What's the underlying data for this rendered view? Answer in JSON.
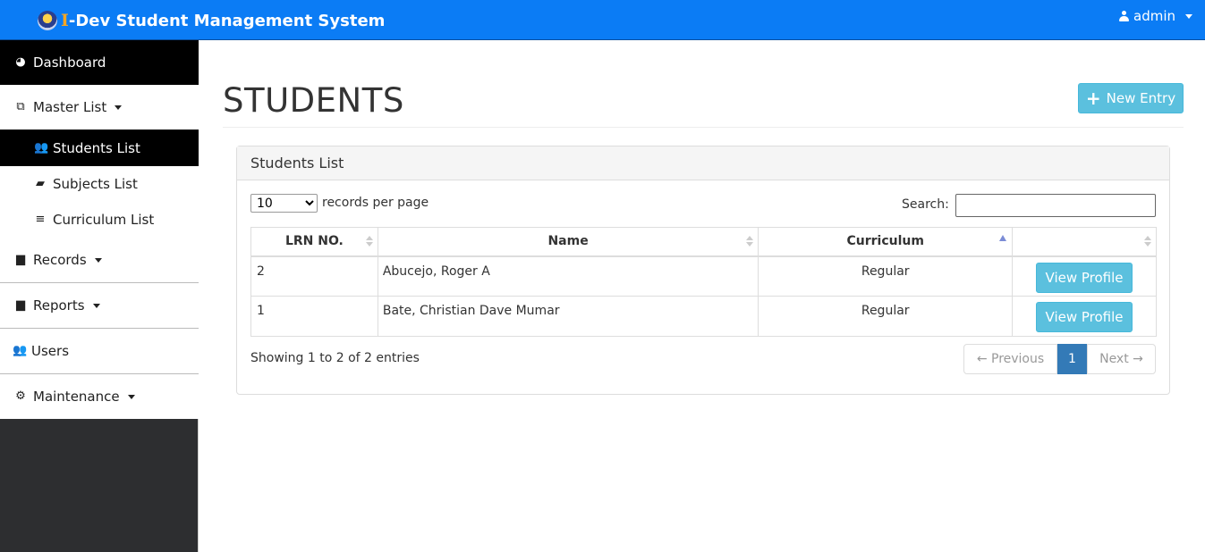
{
  "header": {
    "brand_initial": "I",
    "brand_rest": "-Dev Student Management System",
    "user_label": "admin",
    "colors": {
      "bar": "#0b7cf5",
      "brand_initial": "#f5a623"
    }
  },
  "sidebar": {
    "dashboard": "Dashboard",
    "master_list": "Master List",
    "students_list": "Students List",
    "subjects_list": "Subjects List",
    "curriculum_list": "Curriculum List",
    "records": "Records",
    "reports": "Reports",
    "users": "Users",
    "maintenance": "Maintenance"
  },
  "page": {
    "title": "STUDENTS",
    "new_entry_label": "New Entry"
  },
  "panel": {
    "heading": "Students List",
    "page_length": "10",
    "page_length_label": "records per page",
    "search_label": "Search:",
    "search_value": "",
    "columns": [
      "LRN NO.",
      "Name",
      "Curriculum",
      ""
    ],
    "rows": [
      {
        "lrn": "2",
        "name": "Abucejo, Roger A",
        "curriculum": "Regular",
        "action": "View Profile"
      },
      {
        "lrn": "1",
        "name": "Bate, Christian Dave Mumar",
        "curriculum": "Regular",
        "action": "View Profile"
      }
    ],
    "info": "Showing 1 to 2 of 2 entries",
    "pagination": {
      "previous": "← Previous",
      "current": "1",
      "next": "Next →"
    }
  }
}
